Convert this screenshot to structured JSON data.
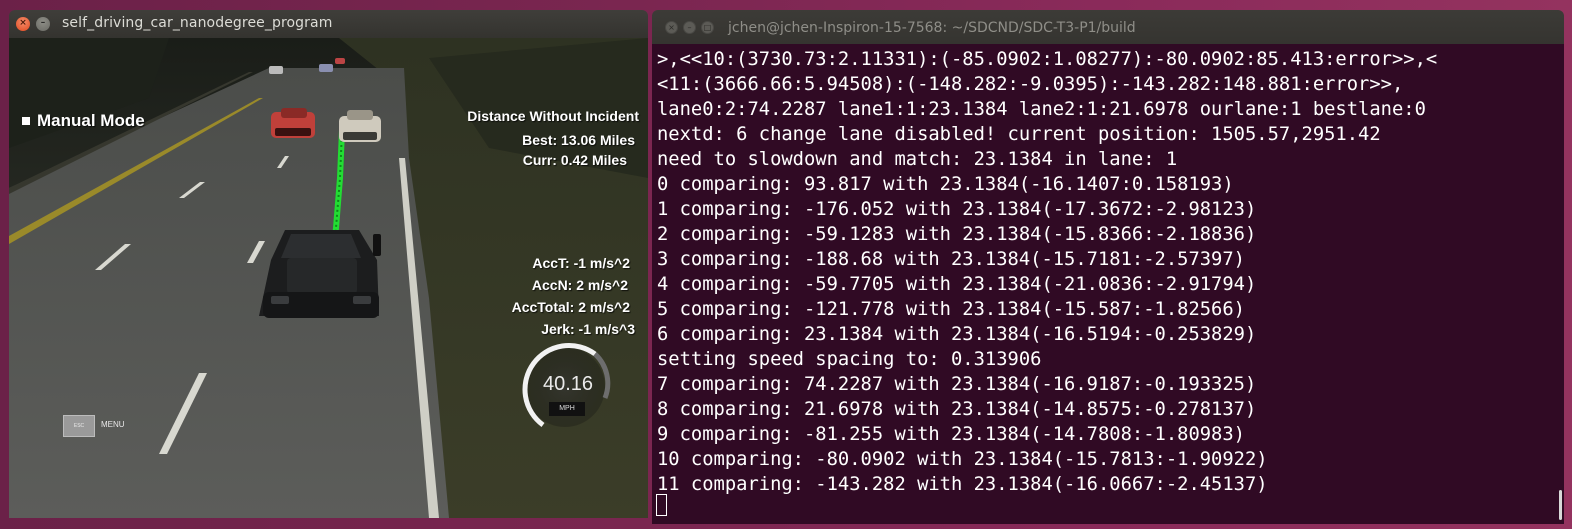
{
  "simulator": {
    "title": "self_driving_car_nanodegree_program",
    "hud": {
      "mode": "Manual Mode",
      "distance_title": "Distance Without Incident",
      "best": "Best: 13.06 Miles",
      "curr": "Curr: 0.42 Miles",
      "acc_t": "AccT: -1 m/s^2",
      "acc_n": "AccN: 2 m/s^2",
      "acc_total": "AccTotal: 2 m/s^2",
      "jerk": "Jerk: -1 m/s^3",
      "speed": "40.16",
      "speed_unit": "MPH",
      "esc_label": "ESC",
      "menu_label": "MENU"
    }
  },
  "terminal": {
    "title": "jchen@jchen-Inspiron-15-7568: ~/SDCND/SDC-T3-P1/build",
    "lines": [
      ">,<<10:(3730.73:2.11331):(-85.0902:1.08277):-80.0902:85.413:error>>,<",
      "<11:(3666.66:5.94508):(-148.282:-9.0395):-143.282:148.881:error>>,",
      "lane0:2:74.2287 lane1:1:23.1384 lane2:1:21.6978 ourlane:1 bestlane:0",
      "nextd: 6 change lane disabled! current position: 1505.57,2951.42",
      "need to slowdown and match: 23.1384 in lane: 1",
      "0 comparing: 93.817 with 23.1384(-16.1407:0.158193)",
      "1 comparing: -176.052 with 23.1384(-17.3672:-2.98123)",
      "2 comparing: -59.1283 with 23.1384(-15.8366:-2.18836)",
      "3 comparing: -188.68 with 23.1384(-15.7181:-2.57397)",
      "4 comparing: -59.7705 with 23.1384(-21.0836:-2.91794)",
      "5 comparing: -121.778 with 23.1384(-15.587:-1.82566)",
      "6 comparing: 23.1384 with 23.1384(-16.5194:-0.253829)",
      "setting speed spacing to: 0.313906",
      "7 comparing: 74.2287 with 23.1384(-16.9187:-0.193325)",
      "8 comparing: 21.6978 with 23.1384(-14.8575:-0.278137)",
      "9 comparing: -81.255 with 23.1384(-14.7808:-1.80983)",
      "10 comparing: -80.0902 with 23.1384(-15.7813:-1.90922)",
      "11 comparing: -143.282 with 23.1384(-16.0667:-2.45137)"
    ]
  },
  "colors": {
    "desktop": "#7a2650",
    "terminal_bg": "#300a24",
    "path_green": "#22dd33"
  }
}
